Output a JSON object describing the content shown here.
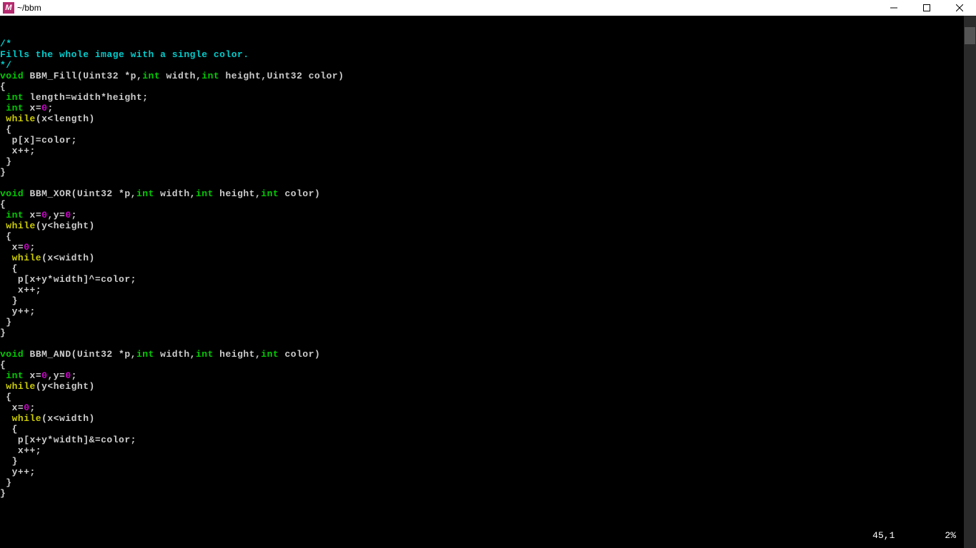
{
  "window": {
    "icon_letter": "M",
    "title": "~/bbm"
  },
  "status": {
    "position": "45,1",
    "percent": "2%"
  },
  "code": {
    "line1": "/*",
    "line2": "Fills the whole image with a single color.",
    "line3": "*/",
    "line4_void": "void",
    "line4_fn": " BBM_Fill(Uint32 *p,",
    "line4_int1": "int",
    "line4_w": " width,",
    "line4_int2": "int",
    "line4_h": " height,Uint32 color)",
    "line5": "{",
    "line6_int": " int",
    "line6_rest": " length=width*height;",
    "line7_int": " int",
    "line7_x": " x=",
    "line7_zero": "0",
    "line7_semi": ";",
    "line8_while": " while",
    "line8_rest": "(x<length)",
    "line9": " {",
    "line10": "  p[x]=color;",
    "line11": "  x++;",
    "line12": " }",
    "line13": "}",
    "line15_void": "void",
    "line15_fn": " BBM_XOR(Uint32 *p,",
    "line15_int1": "int",
    "line15_w": " width,",
    "line15_int2": "int",
    "line15_h": " height,",
    "line15_int3": "int",
    "line15_c": " color)",
    "line16": "{",
    "line17_int": " int",
    "line17_x": " x=",
    "line17_z1": "0",
    "line17_y": ",y=",
    "line17_z2": "0",
    "line17_semi": ";",
    "line18_while": " while",
    "line18_rest": "(y<height)",
    "line19": " {",
    "line20_x": "  x=",
    "line20_z": "0",
    "line20_semi": ";",
    "line21_while": "  while",
    "line21_rest": "(x<width)",
    "line22": "  {",
    "line23": "   p[x+y*width]^=color;",
    "line24": "   x++;",
    "line25": "  }",
    "line26": "  y++;",
    "line27": " }",
    "line28": "}",
    "line30_void": "void",
    "line30_fn": " BBM_AND(Uint32 *p,",
    "line30_int1": "int",
    "line30_w": " width,",
    "line30_int2": "int",
    "line30_h": " height,",
    "line30_int3": "int",
    "line30_c": " color)",
    "line31": "{",
    "line32_int": " int",
    "line32_x": " x=",
    "line32_z1": "0",
    "line32_y": ",y=",
    "line32_z2": "0",
    "line32_semi": ";",
    "line33_while": " while",
    "line33_rest": "(y<height)",
    "line34": " {",
    "line35_x": "  x=",
    "line35_z": "0",
    "line35_semi": ";",
    "line36_while": "  while",
    "line36_rest": "(x<width)",
    "line37": "  {",
    "line38": "   p[x+y*width]&=color;",
    "line39": "   x++;",
    "line40": "  }",
    "line41": "  y++;",
    "line42": " }",
    "line43": "}"
  }
}
